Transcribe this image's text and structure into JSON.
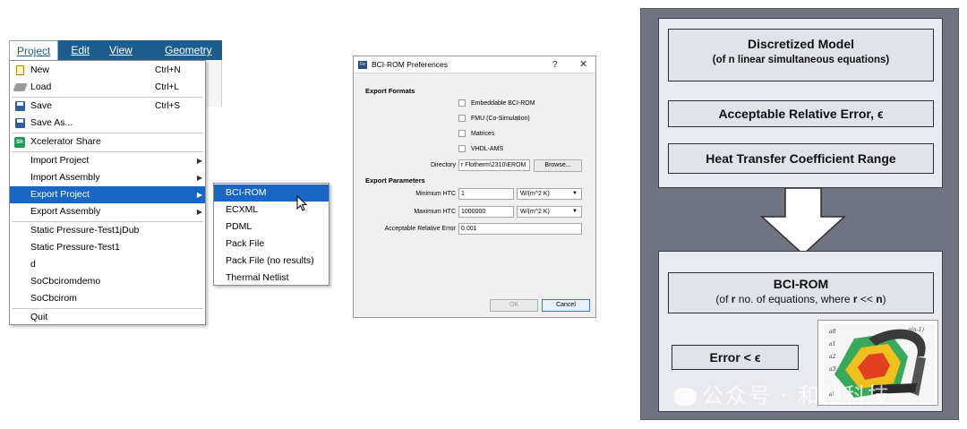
{
  "menu": {
    "menubar": [
      "Project",
      "Edit",
      "View",
      "Geometry"
    ],
    "items": [
      {
        "icon": "new-file-icon",
        "label": "New",
        "shortcut": "Ctrl+N"
      },
      {
        "icon": "load-folder-icon",
        "label": "Load",
        "shortcut": "Ctrl+L"
      },
      {
        "icon": "save-disk-icon",
        "label": "Save",
        "shortcut": "Ctrl+S"
      },
      {
        "icon": "save-as-disk-icon",
        "label": "Save As...",
        "shortcut": ""
      },
      {
        "icon": "xcelerator-share-icon",
        "label": "Xcelerator Share",
        "shortcut": ""
      },
      {
        "icon": "",
        "label": "Import Project",
        "shortcut": ""
      },
      {
        "icon": "",
        "label": "Import Assembly",
        "shortcut": ""
      },
      {
        "icon": "",
        "label": "Export Project",
        "shortcut": ""
      },
      {
        "icon": "",
        "label": "Export Assembly",
        "shortcut": ""
      },
      {
        "icon": "",
        "label": "Static Pressure-Test1jDub",
        "shortcut": ""
      },
      {
        "icon": "",
        "label": "Static Pressure-Test1",
        "shortcut": ""
      },
      {
        "icon": "",
        "label": "d",
        "shortcut": ""
      },
      {
        "icon": "",
        "label": "SoCbciromdemo",
        "shortcut": ""
      },
      {
        "icon": "",
        "label": "SoCbcirom",
        "shortcut": ""
      },
      {
        "icon": "",
        "label": "Quit",
        "shortcut": ""
      }
    ],
    "submenu": [
      "BCI-ROM",
      "ECXML",
      "PDML",
      "Pack File",
      "Pack File (no results)",
      "Thermal Netlist"
    ]
  },
  "dialog": {
    "title": "BCI-ROM Preferences",
    "help": "?",
    "close": "✕",
    "logo_text": "Fe",
    "export_formats_label": "Export Formats",
    "formats": [
      "Embeddable BCI-ROM",
      "FMU (Co-Simulation)",
      "Matrices",
      "VHDL-AMS"
    ],
    "directory_label": "Directory",
    "directory_value": "r Flotherm\\2310\\EROM",
    "browse_label": "Browse...",
    "export_parameters_label": "Export Parameters",
    "min_htc_label": "Minimum HTC",
    "min_htc_value": "1",
    "min_htc_unit": "W/(m^2 K)",
    "max_htc_label": "Maximum HTC",
    "max_htc_value": "1000000",
    "max_htc_unit": "W/(m^2 K)",
    "error_label": "Acceptable Relative Error",
    "error_value": "0.001",
    "ok_label": "OK",
    "cancel_label": "Cancel"
  },
  "diagram": {
    "top_box_1_title": "Discretized Model",
    "top_box_1_sub": "(of n linear simultaneous equations)",
    "top_box_2": "Acceptable Relative Error, ϵ",
    "top_box_3": "Heat Transfer Coefficient Range",
    "bci_title": "BCI-ROM",
    "bci_sub_1": "(of ",
    "bci_sub_r": "r",
    "bci_sub_2": " no. of equations, where ",
    "bci_sub_r2": "r",
    "bci_sub_3": " << ",
    "bci_sub_n": "n",
    "bci_sub_4": ")",
    "error_box": "Error < ϵ",
    "matrix_labels": [
      "a0",
      "a1",
      "a2",
      "a3",
      "ai",
      "a(n-1)"
    ],
    "watermark": "公众号 · 和粒科技"
  }
}
